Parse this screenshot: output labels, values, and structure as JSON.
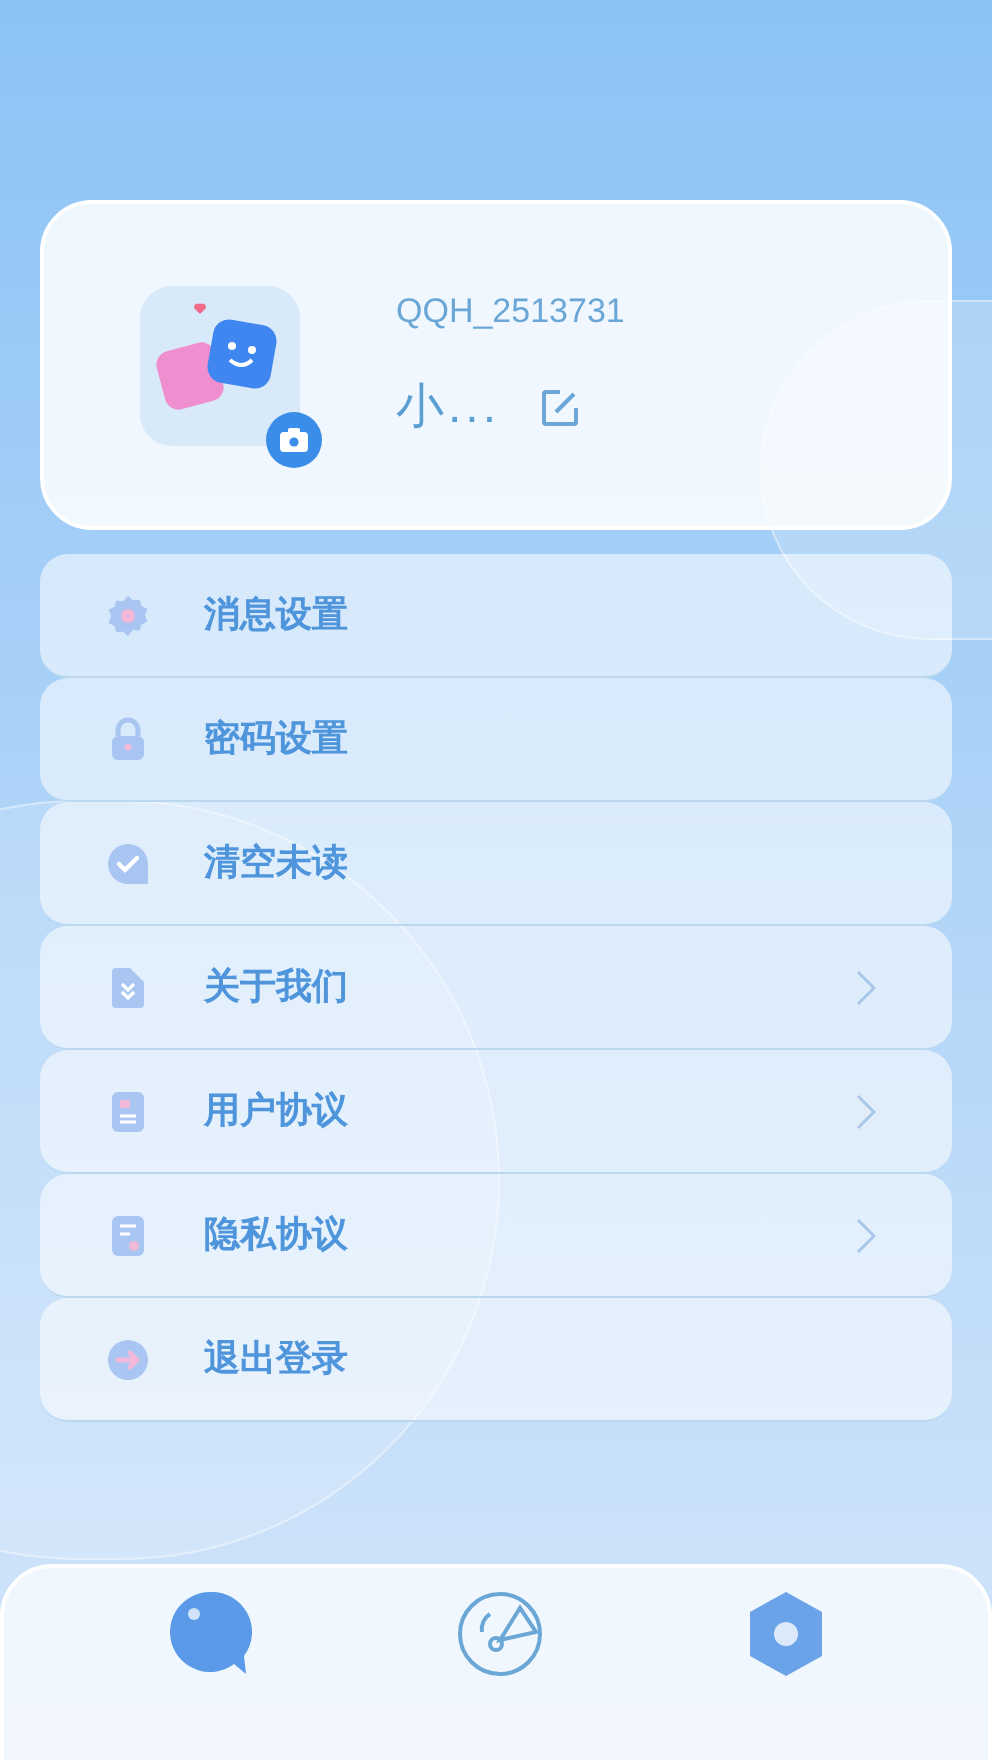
{
  "profile": {
    "user_id": "QQH_2513731",
    "nickname": "小..."
  },
  "menu": [
    {
      "label": "消息设置",
      "chevron": false
    },
    {
      "label": "密码设置",
      "chevron": false
    },
    {
      "label": "清空未读",
      "chevron": false
    },
    {
      "label": "关于我们",
      "chevron": true
    },
    {
      "label": "用户协议",
      "chevron": true
    },
    {
      "label": "隐私协议",
      "chevron": true
    },
    {
      "label": "退出登录",
      "chevron": false
    }
  ]
}
